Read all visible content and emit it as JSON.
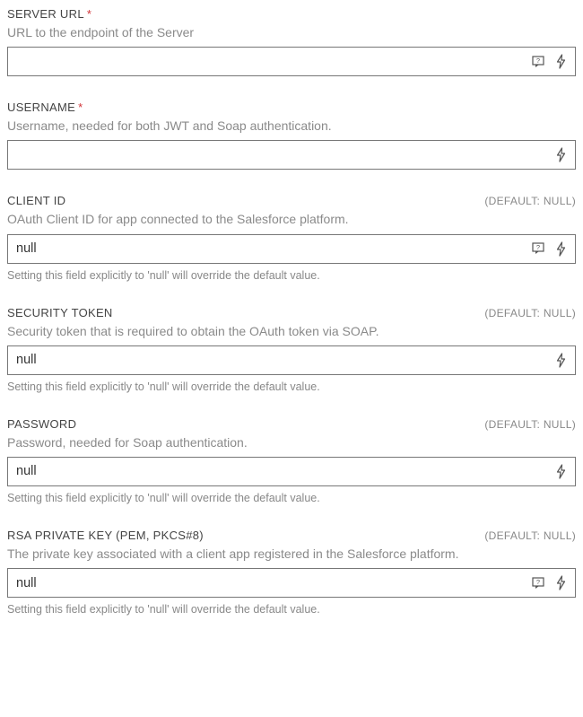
{
  "fields": [
    {
      "label": "SERVER URL",
      "required": true,
      "default": null,
      "desc": "URL to the endpoint of the Server",
      "value": "",
      "showHelp": true,
      "note": null
    },
    {
      "label": "USERNAME",
      "required": true,
      "default": null,
      "desc": "Username, needed for both JWT and Soap authentication.",
      "value": "",
      "showHelp": false,
      "note": null
    },
    {
      "label": "CLIENT ID",
      "required": false,
      "default": "(DEFAULT: NULL)",
      "desc": "OAuth Client ID for app connected to the Salesforce platform.",
      "value": "null",
      "showHelp": true,
      "note": "Setting this field explicitly to 'null' will override the default value."
    },
    {
      "label": "SECURITY TOKEN",
      "required": false,
      "default": "(DEFAULT: NULL)",
      "desc": "Security token that is required to obtain the OAuth token via SOAP.",
      "value": "null",
      "showHelp": false,
      "note": "Setting this field explicitly to 'null' will override the default value."
    },
    {
      "label": "PASSWORD",
      "required": false,
      "default": "(DEFAULT: NULL)",
      "desc": "Password, needed for Soap authentication.",
      "value": "null",
      "showHelp": false,
      "note": "Setting this field explicitly to 'null' will override the default value."
    },
    {
      "label": "RSA PRIVATE KEY (PEM, PKCS#8)",
      "required": false,
      "default": "(DEFAULT: NULL)",
      "desc": "The private key associated with a client app registered in the Salesforce platform.",
      "value": "null",
      "showHelp": true,
      "note": "Setting this field explicitly to 'null' will override the default value."
    }
  ]
}
